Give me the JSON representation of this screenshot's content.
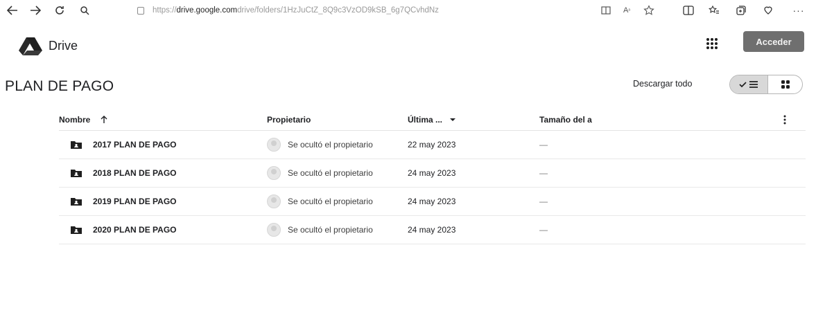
{
  "browser": {
    "url_scheme": "https://",
    "url_host": "drive.google.com",
    "url_path": " drive/folders/1HzJuCtZ_8Q9c3VzOD9kSB_6g7QCvhdNz",
    "icons": [
      "back-arrow-icon",
      "forward-arrow-icon",
      "reload-icon",
      "search-icon",
      "lock-icon",
      "reader-icon",
      "read-aloud-icon",
      "favorite-star-icon",
      "split-screen-icon",
      "favorites-icon",
      "collections-icon",
      "extensions-icon",
      "more-icon"
    ]
  },
  "header": {
    "brand": "Drive",
    "signin_label": "Acceder"
  },
  "folder_title": "PLAN DE PAGO",
  "download_all_label": "Descargar todo",
  "table": {
    "columns": {
      "name": "Nombre",
      "owner": "Propietario",
      "modified": "Última ...",
      "size": "Tamaño del a"
    },
    "rows": [
      {
        "name": "2017 PLAN DE PAGO",
        "owner": "Se ocultó el propietario",
        "date": "22 may 2023",
        "size": "—"
      },
      {
        "name": "2018 PLAN DE PAGO",
        "owner": "Se ocultó el propietario",
        "date": "24 may 2023",
        "size": "—"
      },
      {
        "name": "2019 PLAN DE PAGO",
        "owner": "Se ocultó el propietario",
        "date": "24 may 2023",
        "size": "—"
      },
      {
        "name": "2020 PLAN DE PAGO",
        "owner": "Se ocultó el propietario",
        "date": "24 may 2023",
        "size": "—"
      }
    ]
  },
  "colors": {
    "signin_button": "#6f6f6f",
    "toggle_active": "#d8d8d8"
  }
}
